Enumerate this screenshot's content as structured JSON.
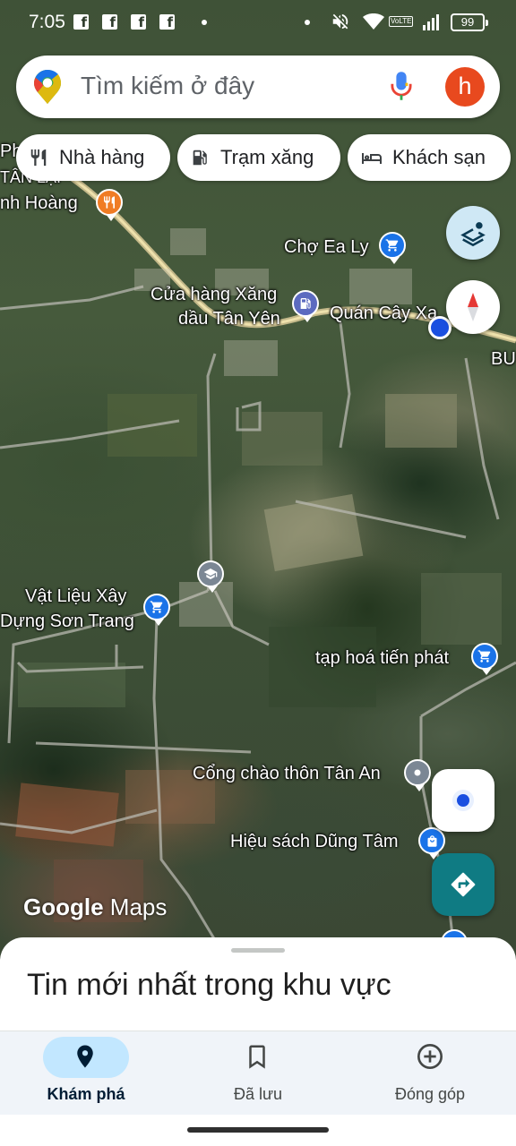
{
  "status_bar": {
    "time": "7:05",
    "battery": "99",
    "network_badge": "VoLTE",
    "icons": [
      "facebook-icon",
      "facebook-icon",
      "facebook-icon",
      "facebook-icon",
      "mute-icon",
      "wifi-icon",
      "signal-icon",
      "battery-icon"
    ]
  },
  "search": {
    "placeholder": "Tìm kiếm ở đây",
    "avatar_letter": "h",
    "avatar_color": "#e8491e"
  },
  "chips": [
    {
      "label": "Nhà hàng",
      "icon": "restaurant-icon"
    },
    {
      "label": "Trạm xăng",
      "icon": "gas-station-icon"
    },
    {
      "label": "Khách sạn",
      "icon": "hotel-icon"
    }
  ],
  "map": {
    "labels": {
      "edge_ph": "Ph",
      "edge_tan_lai": "TÂN LẠI",
      "restaurant_name": "nh Hoàng",
      "market": "Chợ Ea Ly",
      "gas_station_line1": "Cửa hàng Xăng",
      "gas_station_line2": "dầu Tân Yên",
      "cafe": "Quán Cây Xa",
      "edge_bu": "BU",
      "materials_line1": "Vật Liệu Xây",
      "materials_line2": "Dựng Sơn Trang",
      "grocery": "tạp hoá tiến phát",
      "gate": "Cổng chào thôn Tân An",
      "bookstore": "Hiệu sách Dũng Tâm"
    },
    "watermark_google": "Google",
    "watermark_maps": "Maps",
    "colors": {
      "shopping_pin": "#1a73e8",
      "restaurant_pin": "#f07c24",
      "gas_pin": "#5c6bc0",
      "school_pin": "#7b8794",
      "directions_fab": "#0f7b83",
      "location_dot": "#1a4fe0"
    }
  },
  "sheet": {
    "title": "Tin mới nhất trong khu vực"
  },
  "nav": [
    {
      "label": "Khám phá",
      "icon": "explore-pin-icon",
      "active": true
    },
    {
      "label": "Đã lưu",
      "icon": "bookmark-icon",
      "active": false
    },
    {
      "label": "Đóng góp",
      "icon": "add-circle-icon",
      "active": false
    }
  ]
}
